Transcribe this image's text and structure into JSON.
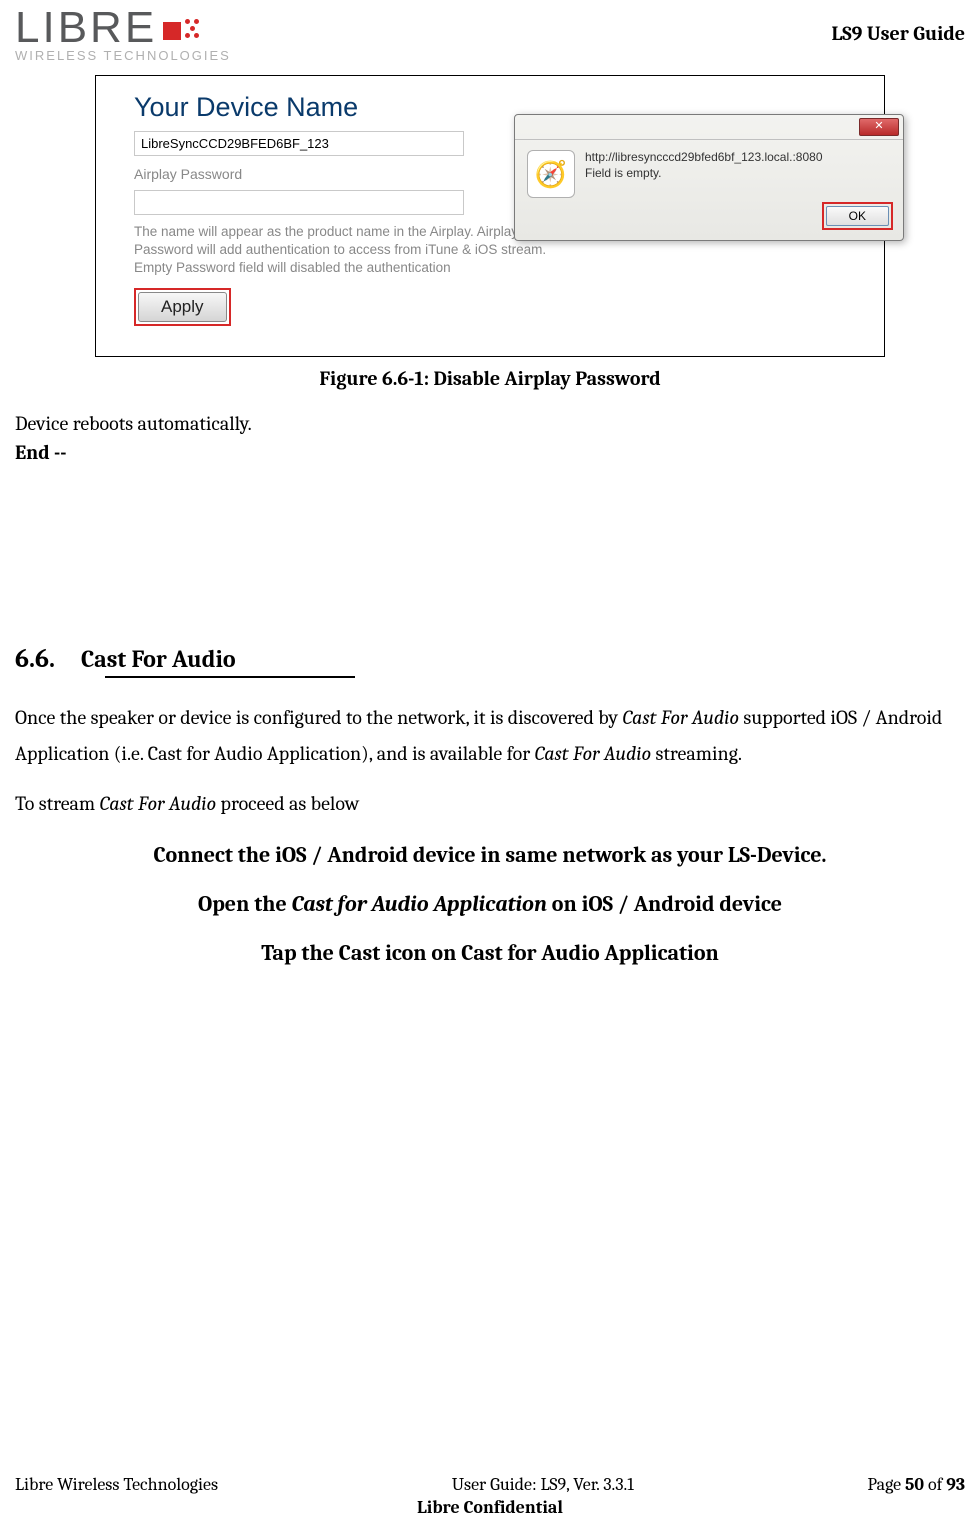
{
  "header": {
    "logo_main": "LIBR",
    "logo_e": "E",
    "logo_sub": "WIRELESS TECHNOLOGIES",
    "title": "LS9 User Guide"
  },
  "figure": {
    "title": "Your Device Name",
    "device_value": "LibreSyncCCD29BFED6BF_123",
    "airplay_label": "Airplay Password",
    "password_value": "",
    "desc": "The name will appear as the product name in the Airplay. Airplay Password will add authentication to access from iTune & iOS stream. Empty Password field will disabled the authentication",
    "apply": "Apply",
    "dialog_url": "http://libresyncccd29bfed6bf_123.local.:8080",
    "dialog_msg": "Field is empty.",
    "dialog_ok": "OK",
    "dialog_close": "✕"
  },
  "caption": "Figure 6.6-1: Disable Airplay Password",
  "text_reboot": "Device reboots automatically.",
  "text_end": "End --",
  "section": {
    "num": "6.6.",
    "title": "Cast For Audio",
    "p1a": "Once the speaker or device is configured to the network, it is discovered by ",
    "p1b": "Cast For Audio",
    "p1c": " supported iOS / Android Application (i.e. Cast for Audio Application), and is available for ",
    "p1d": "Cast For Audio",
    "p1e": " streaming.",
    "p2a": "To stream ",
    "p2b": "Cast For Audio",
    "p2c": " proceed as below",
    "step1": "Connect the iOS / Android device in same network as your LS-Device.",
    "step2a": "Open the ",
    "step2b": "Cast for Audio Application",
    "step2c": " on iOS / Android device",
    "step3": "Tap the Cast icon on Cast for Audio Application"
  },
  "footer": {
    "left": "Libre Wireless Technologies",
    "center": "User Guide: LS9, Ver. 3.3.1",
    "right_a": "Page ",
    "right_b": "50",
    "right_c": " of ",
    "right_d": "93",
    "conf": "Libre Confidential"
  }
}
